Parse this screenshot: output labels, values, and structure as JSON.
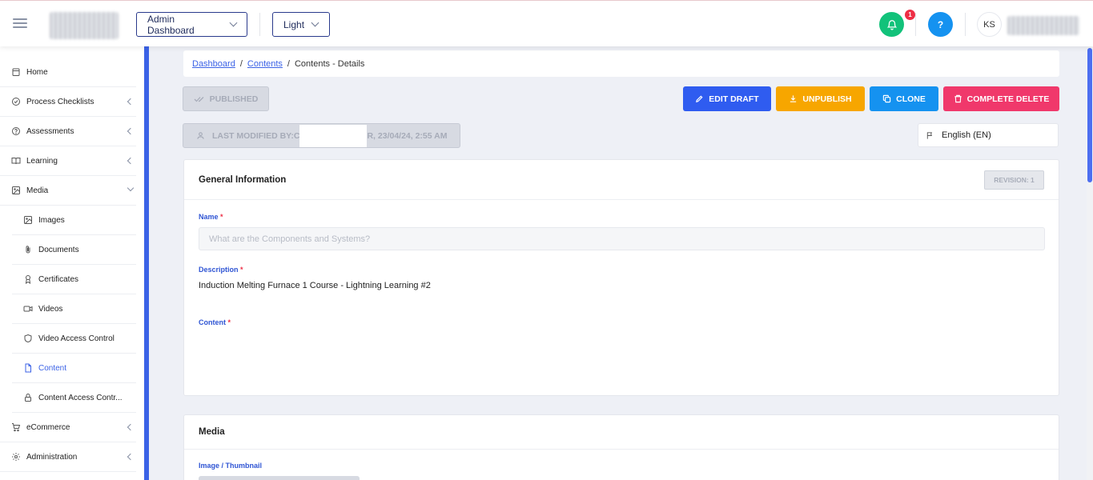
{
  "topbar": {
    "dashboard_select": "Admin Dashboard",
    "theme_select": "Light",
    "notification_count": "1",
    "help_label": "?",
    "user_initials": "KS"
  },
  "sidebar": {
    "items": [
      {
        "label": "Home",
        "icon": "home-icon"
      },
      {
        "label": "Process Checklists",
        "icon": "check-circle-icon"
      },
      {
        "label": "Assessments",
        "icon": "question-circle-icon"
      },
      {
        "label": "Learning",
        "icon": "book-icon"
      },
      {
        "label": "Media",
        "icon": "image-icon"
      }
    ],
    "media_sub": [
      {
        "label": "Images",
        "icon": "image-icon"
      },
      {
        "label": "Documents",
        "icon": "paperclip-icon"
      },
      {
        "label": "Certificates",
        "icon": "award-icon"
      },
      {
        "label": "Videos",
        "icon": "video-icon"
      },
      {
        "label": "Video Access Control",
        "icon": "shield-icon"
      },
      {
        "label": "Content",
        "icon": "file-icon"
      },
      {
        "label": "Content Access Contr...",
        "icon": "lock-icon"
      }
    ],
    "bottom": [
      {
        "label": "eCommerce",
        "icon": "cart-icon"
      },
      {
        "label": "Administration",
        "icon": "gear-icon"
      }
    ]
  },
  "breadcrumb": {
    "dashboard": "Dashboard",
    "contents": "Contents",
    "separator": "/",
    "current": "Contents - Details"
  },
  "actions": {
    "published": "PUBLISHED",
    "edit_draft": "EDIT DRAFT",
    "unpublish": "UNPUBLISH",
    "clone": "CLONE",
    "complete_delete": "COMPLETE DELETE",
    "last_modified_prefix": "LAST MODIFIED BY:C",
    "last_modified_suffix": "R, 23/04/24, 2:55 AM",
    "language": "English (EN)"
  },
  "colors": {
    "accent": "#3b62e6",
    "edit": "#2f5cf0",
    "unpublish": "#f7a600",
    "clone": "#1592f0",
    "delete": "#f0386b",
    "notify": "#12c27a",
    "help": "#1592f0"
  },
  "general": {
    "title": "General Information",
    "revision": "REVISION: 1",
    "name_label": "Name",
    "name_placeholder": "What are the Components and Systems?",
    "description_label": "Description",
    "description_value": "Induction Melting Furnace 1 Course - Lightning Learning #2",
    "content_label": "Content",
    "required_mark": "*"
  },
  "media": {
    "title": "Media",
    "thumbnail_label": "Image / Thumbnail"
  }
}
